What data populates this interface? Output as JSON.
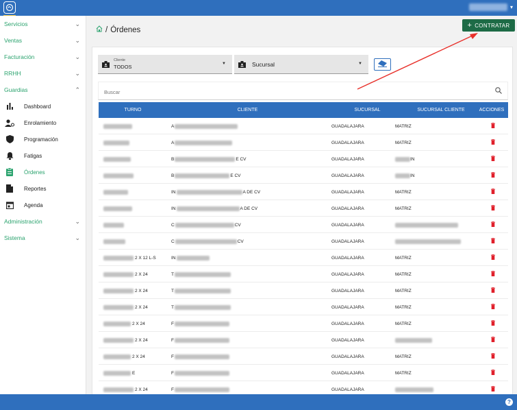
{
  "header": {
    "logo": "logo-icon"
  },
  "sidebar": {
    "sections": [
      {
        "label": "Servicios",
        "expanded": false
      },
      {
        "label": "Ventas",
        "expanded": false
      },
      {
        "label": "Facturación",
        "expanded": false
      },
      {
        "label": "RRHH",
        "expanded": false
      },
      {
        "label": "Guardias",
        "expanded": true
      }
    ],
    "guardias_items": [
      {
        "label": "Dashboard",
        "icon": "bar-chart-icon"
      },
      {
        "label": "Enrolamiento",
        "icon": "user-add-icon"
      },
      {
        "label": "Programación",
        "icon": "shield-icon"
      },
      {
        "label": "Fatigas",
        "icon": "bell-icon"
      },
      {
        "label": "Órdenes",
        "icon": "clipboard-icon",
        "active": true
      },
      {
        "label": "Reportes",
        "icon": "file-icon"
      },
      {
        "label": "Agenda",
        "icon": "calendar-icon"
      }
    ],
    "bottom_sections": [
      {
        "label": "Administración",
        "expanded": false
      },
      {
        "label": "Sistema",
        "expanded": false
      }
    ]
  },
  "page": {
    "breadcrumb_sep": "/",
    "title": "Órdenes",
    "contratar_label": "CONTRATAR"
  },
  "filters": {
    "cliente_label": "Cliente",
    "cliente_value": "TODOS",
    "sucursal_value": "Sucursal"
  },
  "search": {
    "placeholder": "Buscar"
  },
  "table": {
    "headers": [
      "TURNO",
      "CLIENTE",
      "SUCURSAL",
      "SUCURSAL CLIENTE",
      "ACCIONES"
    ],
    "rows": [
      {
        "turno": "",
        "cliente_prefix": "A",
        "cliente_suffix": "",
        "sucursal": "GUADALAJARA",
        "suc_cliente": "MATRIZ"
      },
      {
        "turno": "",
        "cliente_prefix": "A",
        "cliente_suffix": "",
        "sucursal": "GUADALAJARA",
        "suc_cliente": "MATRIZ"
      },
      {
        "turno": "",
        "cliente_prefix": "B",
        "cliente_suffix": "E CV",
        "sucursal": "GUADALAJARA",
        "suc_cliente": "IN"
      },
      {
        "turno": "",
        "cliente_prefix": "B",
        "cliente_suffix": "E CV",
        "sucursal": "GUADALAJARA",
        "suc_cliente": "IN"
      },
      {
        "turno": "",
        "cliente_prefix": "IN",
        "cliente_suffix": "A DE CV",
        "sucursal": "GUADALAJARA",
        "suc_cliente": "MATRIZ"
      },
      {
        "turno": "",
        "cliente_prefix": "IN",
        "cliente_suffix": "A DE CV",
        "sucursal": "GUADALAJARA",
        "suc_cliente": "MATRIZ"
      },
      {
        "turno": "",
        "cliente_prefix": "C",
        "cliente_suffix": "CV",
        "sucursal": "GUADALAJARA",
        "suc_cliente": ""
      },
      {
        "turno": "",
        "cliente_prefix": "C",
        "cliente_suffix": "CV",
        "sucursal": "GUADALAJARA",
        "suc_cliente": ""
      },
      {
        "turno": "2 X 12 L-S",
        "cliente_prefix": "IN",
        "cliente_suffix": "",
        "sucursal": "GUADALAJARA",
        "suc_cliente": "MATRIZ"
      },
      {
        "turno": "2 X 24",
        "cliente_prefix": "T",
        "cliente_suffix": "",
        "sucursal": "GUADALAJARA",
        "suc_cliente": "MATRIZ"
      },
      {
        "turno": "2 X 24",
        "cliente_prefix": "T",
        "cliente_suffix": "",
        "sucursal": "GUADALAJARA",
        "suc_cliente": "MATRIZ"
      },
      {
        "turno": "2 X 24",
        "cliente_prefix": "T",
        "cliente_suffix": "",
        "sucursal": "GUADALAJARA",
        "suc_cliente": "MATRIZ"
      },
      {
        "turno": "2 X 24",
        "cliente_prefix": "F",
        "cliente_suffix": "",
        "sucursal": "GUADALAJARA",
        "suc_cliente": "MATRIZ"
      },
      {
        "turno": "2 X 24",
        "cliente_prefix": "F",
        "cliente_suffix": "",
        "sucursal": "GUADALAJARA",
        "suc_cliente": ""
      },
      {
        "turno": "2 X 24",
        "cliente_prefix": "F",
        "cliente_suffix": "",
        "sucursal": "GUADALAJARA",
        "suc_cliente": "MATRIZ"
      },
      {
        "turno": "E",
        "cliente_prefix": "F",
        "cliente_suffix": "",
        "sucursal": "GUADALAJARA",
        "suc_cliente": "MATRIZ"
      },
      {
        "turno": "2 X 24",
        "cliente_prefix": "F",
        "cliente_suffix": "",
        "sucursal": "GUADALAJARA",
        "suc_cliente": ""
      }
    ]
  },
  "colors": {
    "brand_blue": "#2f6fbd",
    "accent_green": "#2ba36e",
    "contratar_green": "#1d6b46",
    "delete_red": "#e0202b",
    "annotation_red": "#e8302a"
  }
}
